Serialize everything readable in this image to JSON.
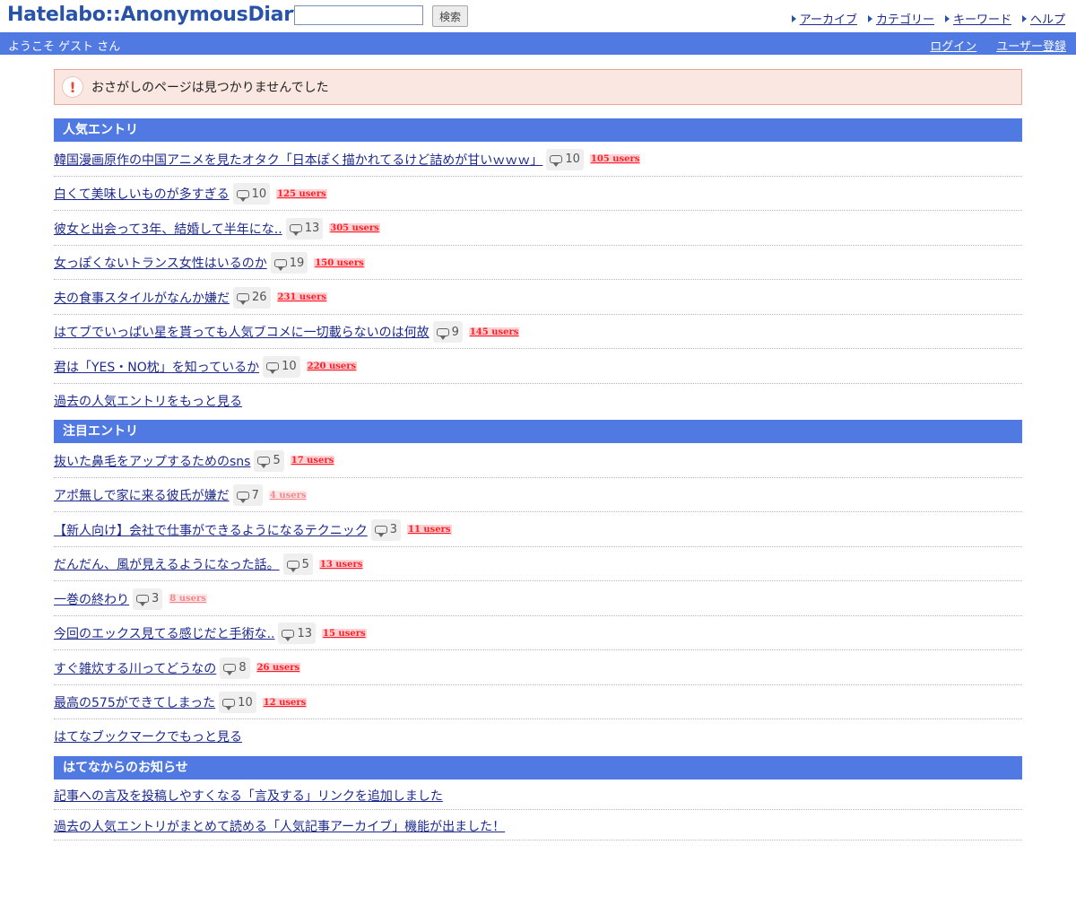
{
  "header": {
    "logo": "Hatelabo::AnonymousDiary",
    "search_placeholder": "",
    "search_button": "検索",
    "nav": [
      "アーカイブ",
      "カテゴリー",
      "キーワード",
      "ヘルプ"
    ]
  },
  "user_bar": {
    "welcome": "ようこそ ゲスト さん",
    "login": "ログイン",
    "register": "ユーザー登録"
  },
  "notice": {
    "message": "おさがしのページは見つかりませんでした"
  },
  "popular": {
    "heading": "人気エントリ",
    "entries": [
      {
        "title": "韓国漫画原作の中国アニメを見たオタク「日本ぽく描かれてるけど詰めが甘いｗｗｗ」",
        "comments": "10",
        "users": "105 users"
      },
      {
        "title": "白くて美味しいものが多すぎる",
        "comments": "10",
        "users": "125 users"
      },
      {
        "title": "彼女と出会って3年、結婚して半年にな..",
        "comments": "13",
        "users": "305 users"
      },
      {
        "title": "女っぽくないトランス女性はいるのか",
        "comments": "19",
        "users": "150 users"
      },
      {
        "title": "夫の食事スタイルがなんか嫌だ",
        "comments": "26",
        "users": "231 users"
      },
      {
        "title": "はてブでいっぱい星を貰っても人気ブコメに一切載らないのは何故",
        "comments": "9",
        "users": "145 users"
      },
      {
        "title": "君は「YES・NO枕」を知っているか",
        "comments": "10",
        "users": "220 users"
      }
    ],
    "more": "過去の人気エントリをもっと見る"
  },
  "featured": {
    "heading": "注目エントリ",
    "entries": [
      {
        "title": "抜いた鼻毛をアップするためのsns",
        "comments": "5",
        "users": "17 users"
      },
      {
        "title": "アポ無しで家に来る彼氏が嫌だ",
        "comments": "7",
        "users": "4 users"
      },
      {
        "title": "【新人向け】会社で仕事ができるようになるテクニック",
        "comments": "3",
        "users": "11 users"
      },
      {
        "title": "だんだん、風が見えるようになった話。",
        "comments": "5",
        "users": "13 users"
      },
      {
        "title": "一巻の終わり",
        "comments": "3",
        "users": "8 users"
      },
      {
        "title": "今回のエックス見てる感じだと手術な..",
        "comments": "13",
        "users": "15 users"
      },
      {
        "title": "すぐ雑炊する川ってどうなの",
        "comments": "8",
        "users": "26 users"
      },
      {
        "title": "最高の575ができてしまった",
        "comments": "10",
        "users": "12 users"
      }
    ],
    "more": "はてなブックマークでもっと見る"
  },
  "news": {
    "heading": "はてなからのお知らせ",
    "items": [
      "記事への言及を投稿しやすくなる「言及する」リンクを追加しました",
      "過去の人気エントリがまとめて読める「人気記事アーカイブ」機能が出ました！"
    ]
  }
}
